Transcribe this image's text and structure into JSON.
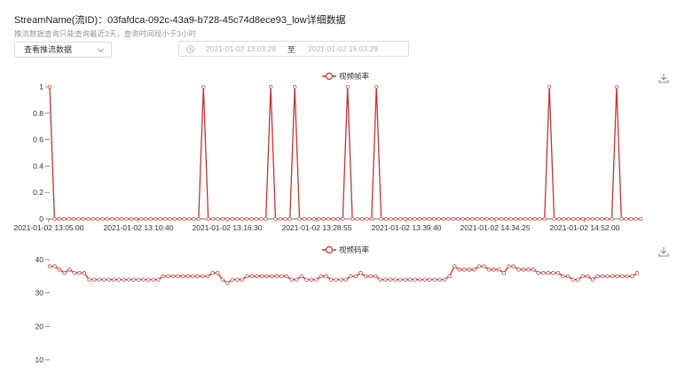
{
  "header": {
    "title": "StreamName(流ID)：03fafdca-092c-43a9-b728-45c74d8ece93_low详细数据",
    "subtitle": "推流数据查询只能查询最近3天，查询时间段小于3小时"
  },
  "filters": {
    "select_value": "查看推流数据",
    "start_time": "2021-01-02 13:03:29",
    "separator": "至",
    "end_time": "2021-01-02 15:03:29"
  },
  "colors": {
    "series": "#c23531",
    "axis": "#6e7079",
    "grid": "#e0e6f1"
  },
  "chart_data": [
    {
      "type": "line",
      "legend": "视频帧率",
      "ylim": [
        0,
        1
      ],
      "yticks": [
        "0",
        "0.2",
        "0.4",
        "0.6",
        "0.8",
        "1"
      ],
      "x_ticks": [
        "2021-01-02 13:05:00",
        "2021-01-02 13:10:40",
        "2021-01-02 13:16:30",
        "2021-01-02 13:28:55",
        "2021-01-02 13:39:40",
        "2021-01-02 14:34:25",
        "2021-01-02 14:52:00"
      ],
      "n_points": 120,
      "values": [
        1,
        0,
        0,
        0,
        0,
        0,
        0,
        0,
        0,
        0,
        0,
        0,
        0,
        0,
        0,
        0,
        0,
        0,
        0,
        0,
        0,
        0,
        0,
        0,
        0,
        0,
        0,
        0,
        0,
        0,
        0,
        0,
        1,
        0,
        0,
        0,
        0,
        0,
        0,
        0,
        0,
        0,
        0,
        0,
        0,
        0,
        1,
        0,
        0,
        0,
        0,
        1,
        0,
        0,
        0,
        0,
        0,
        0,
        0,
        0,
        0,
        0,
        1,
        0,
        0,
        0,
        0,
        0,
        1,
        0,
        0,
        0,
        0,
        0,
        0,
        0,
        0,
        0,
        0,
        0,
        0,
        0,
        0,
        0,
        0,
        0,
        0,
        0,
        0,
        0,
        0,
        0,
        0,
        0,
        0,
        0,
        0,
        0,
        0,
        0,
        0,
        0,
        0,
        0,
        1,
        0,
        0,
        0,
        0,
        0,
        0,
        0,
        0,
        0,
        0,
        0,
        0,
        0,
        1,
        0,
        0,
        0,
        0,
        0
      ]
    },
    {
      "type": "line",
      "legend": "视频码率",
      "ylim": [
        10,
        40
      ],
      "yticks": [
        "10",
        "20",
        "30",
        "40"
      ],
      "n_points": 120,
      "values": [
        38,
        38,
        37,
        36,
        37,
        36,
        36,
        36,
        34,
        34,
        34,
        34,
        34,
        34,
        34,
        34,
        34,
        34,
        34,
        34,
        34,
        34,
        34,
        35,
        35,
        35,
        35,
        35,
        35,
        35,
        35,
        35,
        35,
        36,
        36,
        34,
        33,
        34,
        34,
        34,
        35,
        35,
        35,
        35,
        35,
        35,
        35,
        35,
        35,
        34,
        34,
        35,
        34,
        34,
        34,
        35,
        35,
        34,
        34,
        34,
        34,
        35,
        35,
        36,
        35,
        35,
        35,
        34,
        34,
        34,
        34,
        34,
        34,
        34,
        34,
        34,
        34,
        34,
        34,
        34,
        34,
        35,
        38,
        37,
        37,
        37,
        37,
        38,
        38,
        37,
        37,
        37,
        36,
        38,
        38,
        37,
        37,
        37,
        37,
        36,
        36,
        36,
        36,
        36,
        35,
        35,
        34,
        34,
        35,
        35,
        34,
        35,
        35,
        35,
        35,
        35,
        35,
        35,
        35,
        36
      ]
    }
  ]
}
